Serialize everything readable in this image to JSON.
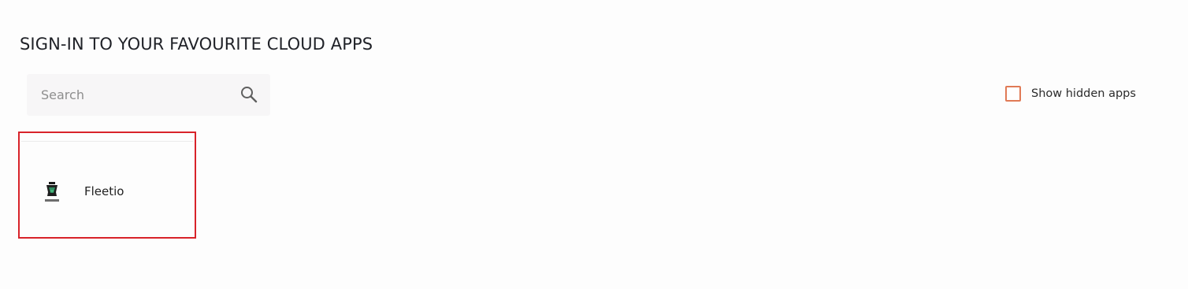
{
  "header": {
    "title": "SIGN-IN TO YOUR FAVOURITE CLOUD APPS"
  },
  "search": {
    "placeholder": "Search",
    "value": "",
    "icon": "search-icon"
  },
  "filters": {
    "show_hidden_label": "Show hidden apps",
    "show_hidden_checked": false,
    "accent_color": "#e07a56"
  },
  "apps": [
    {
      "name": "Fleetio",
      "logo_text": "Fleetio",
      "selected": true,
      "highlight_color": "#d8232a"
    }
  ]
}
